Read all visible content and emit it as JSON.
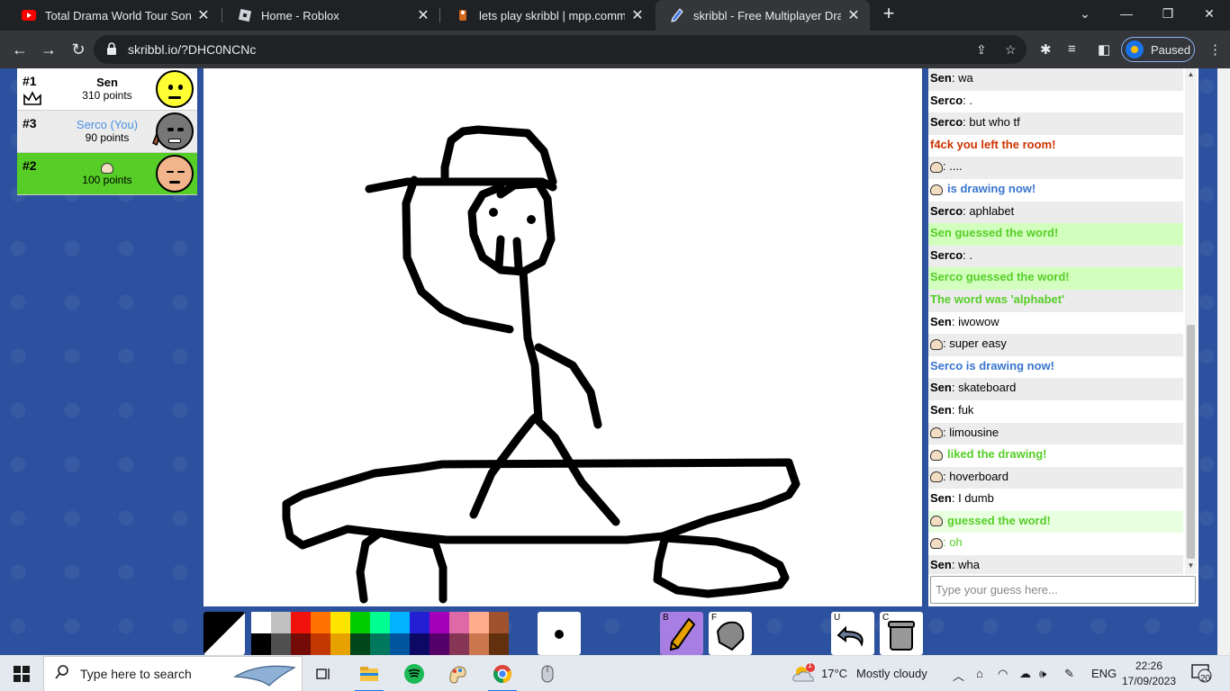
{
  "browser": {
    "tabs": [
      {
        "title": "Total Drama World Tour Songs, b",
        "icon": "youtube-icon",
        "active": false
      },
      {
        "title": "Home - Roblox",
        "icon": "roblox-icon",
        "active": false
      },
      {
        "title": "lets play skribbl | mpp.communit",
        "icon": "mpp-icon",
        "active": false
      },
      {
        "title": "skribbl - Free Multiplayer Drawin",
        "icon": "skribbl-pencil-icon",
        "active": true
      }
    ],
    "url": "skribbl.io/?DHC0NCNc",
    "profile_label": "Paused"
  },
  "players": [
    {
      "rank": "#1",
      "name": "Sen",
      "points": "310 points",
      "face_color": "#ffff33",
      "is_you": false,
      "highlight": false
    },
    {
      "rank": "#3",
      "name": "Serco (You)",
      "points": "90 points",
      "face_color": "#777777",
      "is_you": true,
      "highlight": false
    },
    {
      "rank": "#2",
      "name": "",
      "points": "100 points",
      "face_color": "#f2b48a",
      "is_you": false,
      "highlight": true
    }
  ],
  "palette": {
    "top": [
      "#ffffff",
      "#c1c1c1",
      "#ef130b",
      "#ff7100",
      "#ffe400",
      "#00cc00",
      "#00ff91",
      "#00b2ff",
      "#231fd3",
      "#a300ba",
      "#df69a7",
      "#ffac8e",
      "#a0522d"
    ],
    "bottom": [
      "#000000",
      "#505050",
      "#740b07",
      "#c23800",
      "#e8a200",
      "#004619",
      "#00785d",
      "#00569e",
      "#0e0865",
      "#550069",
      "#873554",
      "#cc774d",
      "#63300d"
    ]
  },
  "tools": {
    "brush_key": "B",
    "fill_key": "F",
    "undo_key": "U",
    "clear_key": "C"
  },
  "chat": {
    "messages": [
      {
        "who": "Sen",
        "text": "wa",
        "kind": "normal"
      },
      {
        "who": "Serco",
        "text": ".",
        "kind": "normal"
      },
      {
        "who": "Serco",
        "text": "but who tf",
        "kind": "normal"
      },
      {
        "who": "",
        "text": "f4ck you left the room!",
        "kind": "sys-red"
      },
      {
        "who": "avatar",
        "text": ": ....",
        "kind": "normal"
      },
      {
        "who": "avatar",
        "text": "is drawing now!",
        "kind": "sys-blue"
      },
      {
        "who": "Serco",
        "text": "aphlabet",
        "kind": "normal"
      },
      {
        "who": "",
        "text": "Sen guessed the word!",
        "kind": "guessed"
      },
      {
        "who": "Serco",
        "text": ".",
        "kind": "normal"
      },
      {
        "who": "",
        "text": "Serco guessed the word!",
        "kind": "guessed"
      },
      {
        "who": "",
        "text": "The word was 'alphabet'",
        "kind": "sys-green"
      },
      {
        "who": "Sen",
        "text": "iwowow",
        "kind": "normal"
      },
      {
        "who": "avatar",
        "text": ": super easy",
        "kind": "normal"
      },
      {
        "who": "",
        "text": "Serco is drawing now!",
        "kind": "sys-blue"
      },
      {
        "who": "Sen",
        "text": "skateboard",
        "kind": "normal"
      },
      {
        "who": "Sen",
        "text": "fuk",
        "kind": "normal"
      },
      {
        "who": "avatar",
        "text": ": limousine",
        "kind": "normal"
      },
      {
        "who": "avatar",
        "text": "liked the drawing!",
        "kind": "sys-green"
      },
      {
        "who": "avatar",
        "text": ": hoverboard",
        "kind": "normal"
      },
      {
        "who": "Sen",
        "text": "I dumb",
        "kind": "normal"
      },
      {
        "who": "avatar",
        "text": "guessed the word!",
        "kind": "close-guess"
      },
      {
        "who": "avatar",
        "text": ": oh",
        "kind": "muted"
      },
      {
        "who": "Sen",
        "text": "wha",
        "kind": "normal"
      }
    ],
    "input_placeholder": "Type your guess here..."
  },
  "taskbar": {
    "search_placeholder": "Type here to search",
    "weather_temp": "17°C",
    "weather_desc": "Mostly cloudy",
    "weather_badge": "1",
    "lang": "ENG",
    "time": "22:26",
    "date": "17/09/2023",
    "notifications": "20"
  }
}
